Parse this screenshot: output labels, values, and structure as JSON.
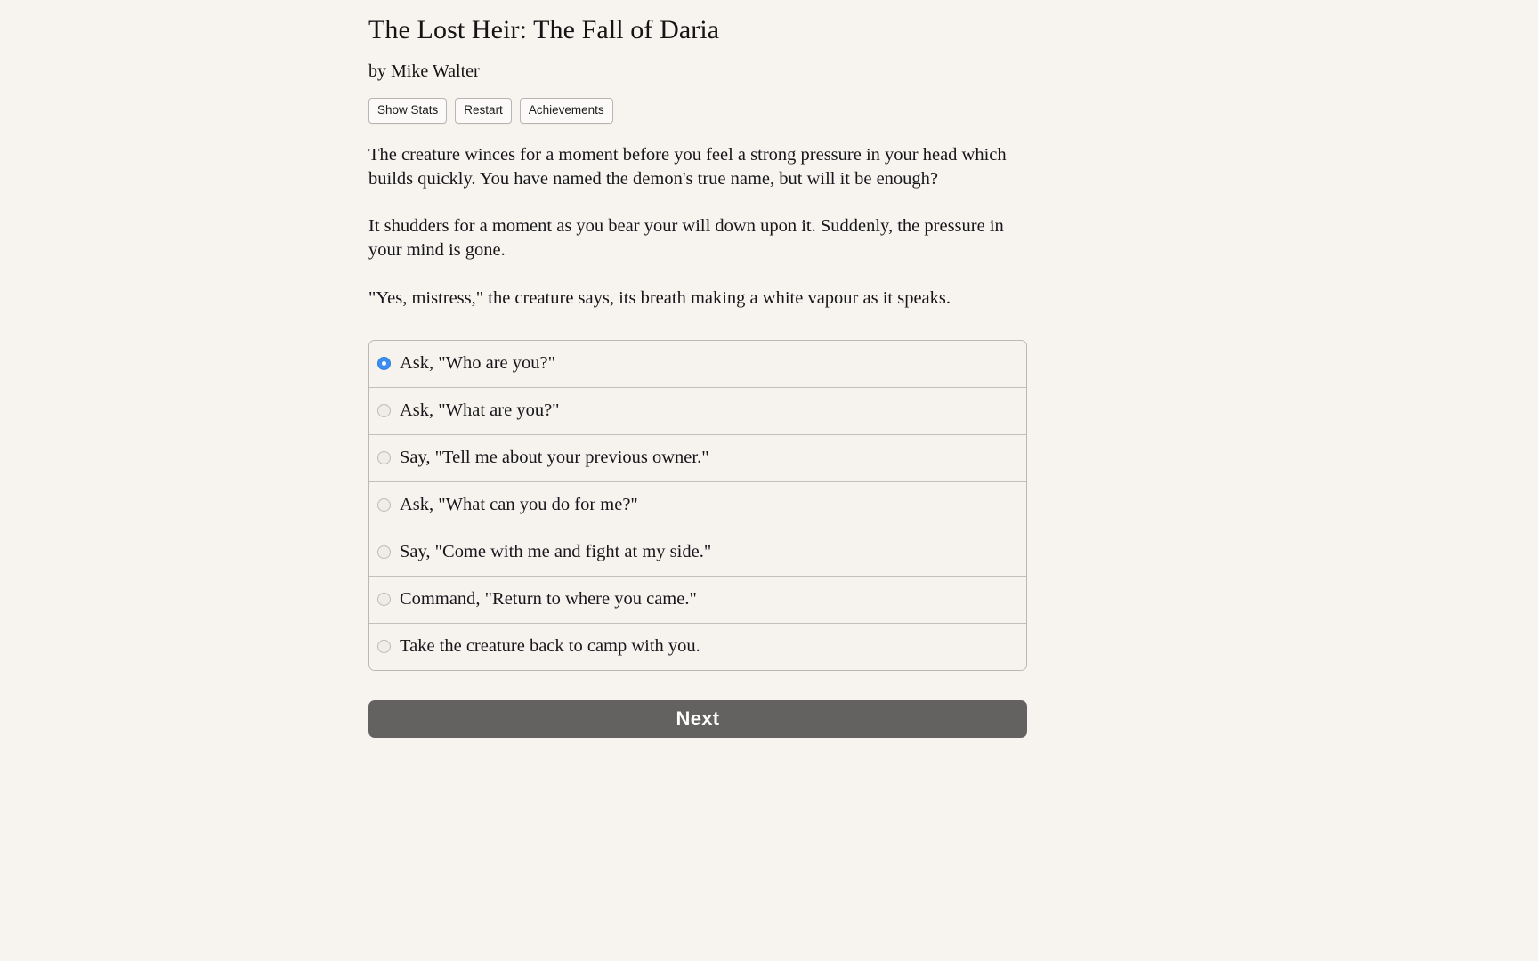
{
  "header": {
    "title": "The Lost Heir: The Fall of Daria",
    "author": "by Mike Walter"
  },
  "toolbar": {
    "show_stats_label": "Show Stats",
    "restart_label": "Restart",
    "achievements_label": "Achievements"
  },
  "story": {
    "paragraphs": [
      "The creature winces for a moment before you feel a strong pressure in your head which builds quickly. You have named the demon's true name, but will it be enough?",
      "It shudders for a moment as you bear your will down upon it. Suddenly, the pressure in your mind is gone.",
      "\"Yes, mistress,\" the creature says, its breath making a white vapour as it speaks."
    ]
  },
  "choices": [
    {
      "label": "Ask, \"Who are you?\"",
      "selected": true
    },
    {
      "label": "Ask, \"What are you?\"",
      "selected": false
    },
    {
      "label": "Say, \"Tell me about your previous owner.\"",
      "selected": false
    },
    {
      "label": "Ask, \"What can you do for me?\"",
      "selected": false
    },
    {
      "label": "Say, \"Come with me and fight at my side.\"",
      "selected": false
    },
    {
      "label": "Command, \"Return to where you came.\"",
      "selected": false
    },
    {
      "label": "Take the creature back to camp with you.",
      "selected": false
    }
  ],
  "actions": {
    "next_label": "Next"
  },
  "colors": {
    "page_background": "#f7f4f0",
    "next_button": "#646260",
    "radio_selected": "#3c8ef0",
    "border": "#bbb7b3"
  }
}
